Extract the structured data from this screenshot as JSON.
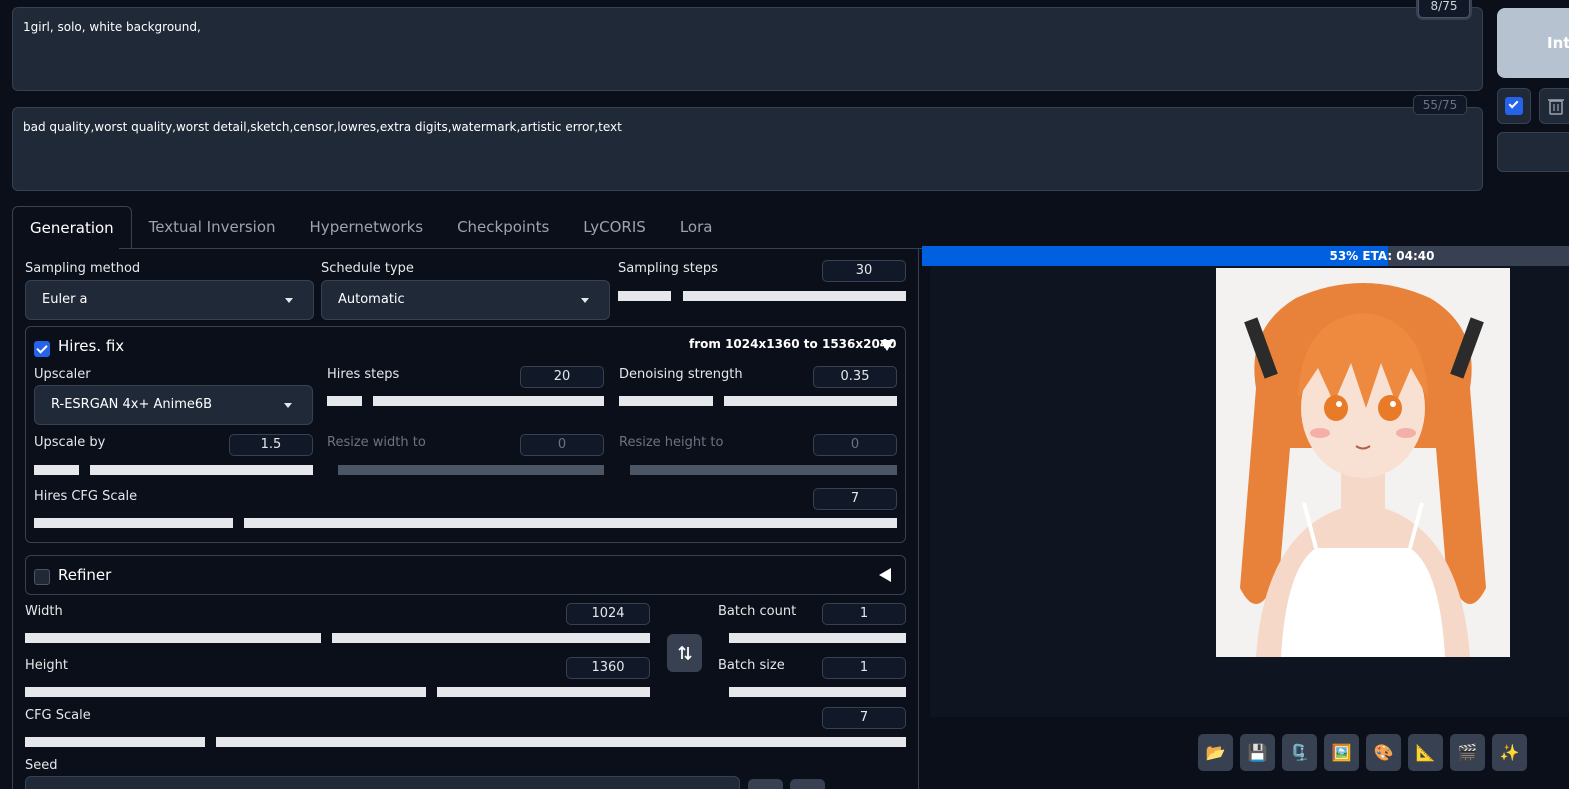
{
  "prompt": {
    "positive": "1girl, solo, white background,",
    "negative": "bad quality,worst quality,worst detail,sketch,censor,lowres,extra digits,watermark,artistic error,text",
    "token_count": "8/75",
    "neg_token_count": "55/75"
  },
  "actions": {
    "generate_label": "Inte"
  },
  "tabs": [
    "Generation",
    "Textual Inversion",
    "Hypernetworks",
    "Checkpoints",
    "LyCORIS",
    "Lora"
  ],
  "sampling": {
    "method_label": "Sampling method",
    "method_value": "Euler a",
    "schedule_label": "Schedule type",
    "schedule_value": "Automatic",
    "steps_label": "Sampling steps",
    "steps_value": "30"
  },
  "hires": {
    "title": "Hires. fix",
    "summary_prefix": "from ",
    "from_size": "1024x1360",
    "summary_mid": " to ",
    "to_size": "1536x2040",
    "upscaler_label": "Upscaler",
    "upscaler_value": "R-ESRGAN 4x+ Anime6B",
    "steps_label": "Hires steps",
    "steps_value": "20",
    "denoise_label": "Denoising strength",
    "denoise_value": "0.35",
    "upscale_by_label": "Upscale by",
    "upscale_by_value": "1.5",
    "resize_w_label": "Resize width to",
    "resize_w_value": "0",
    "resize_h_label": "Resize height to",
    "resize_h_value": "0",
    "cfg_label": "Hires CFG Scale",
    "cfg_value": "7"
  },
  "refiner": {
    "title": "Refiner"
  },
  "dims": {
    "width_label": "Width",
    "width_value": "1024",
    "height_label": "Height",
    "height_value": "1360",
    "batch_count_label": "Batch count",
    "batch_count_value": "1",
    "batch_size_label": "Batch size",
    "batch_size_value": "1",
    "cfg_label": "CFG Scale",
    "cfg_value": "7",
    "seed_label": "Seed"
  },
  "progress": {
    "text": "53% ETA: 04:40",
    "fraction": 0.53
  },
  "toolbar_icons": [
    "📂",
    "💾",
    "🗜️",
    "🖼️",
    "🎨",
    "📐",
    "🎬",
    "✨"
  ]
}
